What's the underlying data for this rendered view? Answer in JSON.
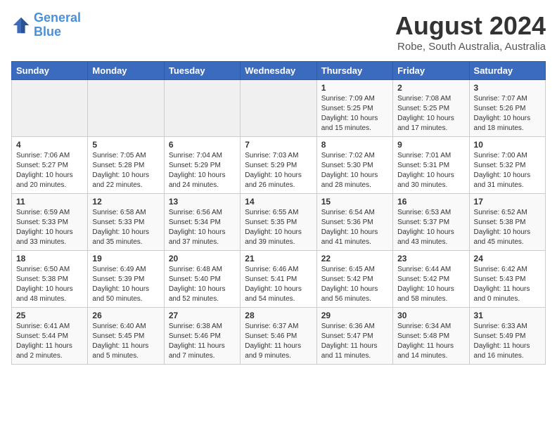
{
  "logo": {
    "line1": "General",
    "line2": "Blue"
  },
  "title": {
    "month_year": "August 2024",
    "location": "Robe, South Australia, Australia"
  },
  "days_of_week": [
    "Sunday",
    "Monday",
    "Tuesday",
    "Wednesday",
    "Thursday",
    "Friday",
    "Saturday"
  ],
  "weeks": [
    [
      {
        "day": "",
        "info": ""
      },
      {
        "day": "",
        "info": ""
      },
      {
        "day": "",
        "info": ""
      },
      {
        "day": "",
        "info": ""
      },
      {
        "day": "1",
        "info": "Sunrise: 7:09 AM\nSunset: 5:25 PM\nDaylight: 10 hours\nand 15 minutes."
      },
      {
        "day": "2",
        "info": "Sunrise: 7:08 AM\nSunset: 5:25 PM\nDaylight: 10 hours\nand 17 minutes."
      },
      {
        "day": "3",
        "info": "Sunrise: 7:07 AM\nSunset: 5:26 PM\nDaylight: 10 hours\nand 18 minutes."
      }
    ],
    [
      {
        "day": "4",
        "info": "Sunrise: 7:06 AM\nSunset: 5:27 PM\nDaylight: 10 hours\nand 20 minutes."
      },
      {
        "day": "5",
        "info": "Sunrise: 7:05 AM\nSunset: 5:28 PM\nDaylight: 10 hours\nand 22 minutes."
      },
      {
        "day": "6",
        "info": "Sunrise: 7:04 AM\nSunset: 5:29 PM\nDaylight: 10 hours\nand 24 minutes."
      },
      {
        "day": "7",
        "info": "Sunrise: 7:03 AM\nSunset: 5:29 PM\nDaylight: 10 hours\nand 26 minutes."
      },
      {
        "day": "8",
        "info": "Sunrise: 7:02 AM\nSunset: 5:30 PM\nDaylight: 10 hours\nand 28 minutes."
      },
      {
        "day": "9",
        "info": "Sunrise: 7:01 AM\nSunset: 5:31 PM\nDaylight: 10 hours\nand 30 minutes."
      },
      {
        "day": "10",
        "info": "Sunrise: 7:00 AM\nSunset: 5:32 PM\nDaylight: 10 hours\nand 31 minutes."
      }
    ],
    [
      {
        "day": "11",
        "info": "Sunrise: 6:59 AM\nSunset: 5:33 PM\nDaylight: 10 hours\nand 33 minutes."
      },
      {
        "day": "12",
        "info": "Sunrise: 6:58 AM\nSunset: 5:33 PM\nDaylight: 10 hours\nand 35 minutes."
      },
      {
        "day": "13",
        "info": "Sunrise: 6:56 AM\nSunset: 5:34 PM\nDaylight: 10 hours\nand 37 minutes."
      },
      {
        "day": "14",
        "info": "Sunrise: 6:55 AM\nSunset: 5:35 PM\nDaylight: 10 hours\nand 39 minutes."
      },
      {
        "day": "15",
        "info": "Sunrise: 6:54 AM\nSunset: 5:36 PM\nDaylight: 10 hours\nand 41 minutes."
      },
      {
        "day": "16",
        "info": "Sunrise: 6:53 AM\nSunset: 5:37 PM\nDaylight: 10 hours\nand 43 minutes."
      },
      {
        "day": "17",
        "info": "Sunrise: 6:52 AM\nSunset: 5:38 PM\nDaylight: 10 hours\nand 45 minutes."
      }
    ],
    [
      {
        "day": "18",
        "info": "Sunrise: 6:50 AM\nSunset: 5:38 PM\nDaylight: 10 hours\nand 48 minutes."
      },
      {
        "day": "19",
        "info": "Sunrise: 6:49 AM\nSunset: 5:39 PM\nDaylight: 10 hours\nand 50 minutes."
      },
      {
        "day": "20",
        "info": "Sunrise: 6:48 AM\nSunset: 5:40 PM\nDaylight: 10 hours\nand 52 minutes."
      },
      {
        "day": "21",
        "info": "Sunrise: 6:46 AM\nSunset: 5:41 PM\nDaylight: 10 hours\nand 54 minutes."
      },
      {
        "day": "22",
        "info": "Sunrise: 6:45 AM\nSunset: 5:42 PM\nDaylight: 10 hours\nand 56 minutes."
      },
      {
        "day": "23",
        "info": "Sunrise: 6:44 AM\nSunset: 5:42 PM\nDaylight: 10 hours\nand 58 minutes."
      },
      {
        "day": "24",
        "info": "Sunrise: 6:42 AM\nSunset: 5:43 PM\nDaylight: 11 hours\nand 0 minutes."
      }
    ],
    [
      {
        "day": "25",
        "info": "Sunrise: 6:41 AM\nSunset: 5:44 PM\nDaylight: 11 hours\nand 2 minutes."
      },
      {
        "day": "26",
        "info": "Sunrise: 6:40 AM\nSunset: 5:45 PM\nDaylight: 11 hours\nand 5 minutes."
      },
      {
        "day": "27",
        "info": "Sunrise: 6:38 AM\nSunset: 5:46 PM\nDaylight: 11 hours\nand 7 minutes."
      },
      {
        "day": "28",
        "info": "Sunrise: 6:37 AM\nSunset: 5:46 PM\nDaylight: 11 hours\nand 9 minutes."
      },
      {
        "day": "29",
        "info": "Sunrise: 6:36 AM\nSunset: 5:47 PM\nDaylight: 11 hours\nand 11 minutes."
      },
      {
        "day": "30",
        "info": "Sunrise: 6:34 AM\nSunset: 5:48 PM\nDaylight: 11 hours\nand 14 minutes."
      },
      {
        "day": "31",
        "info": "Sunrise: 6:33 AM\nSunset: 5:49 PM\nDaylight: 11 hours\nand 16 minutes."
      }
    ]
  ]
}
